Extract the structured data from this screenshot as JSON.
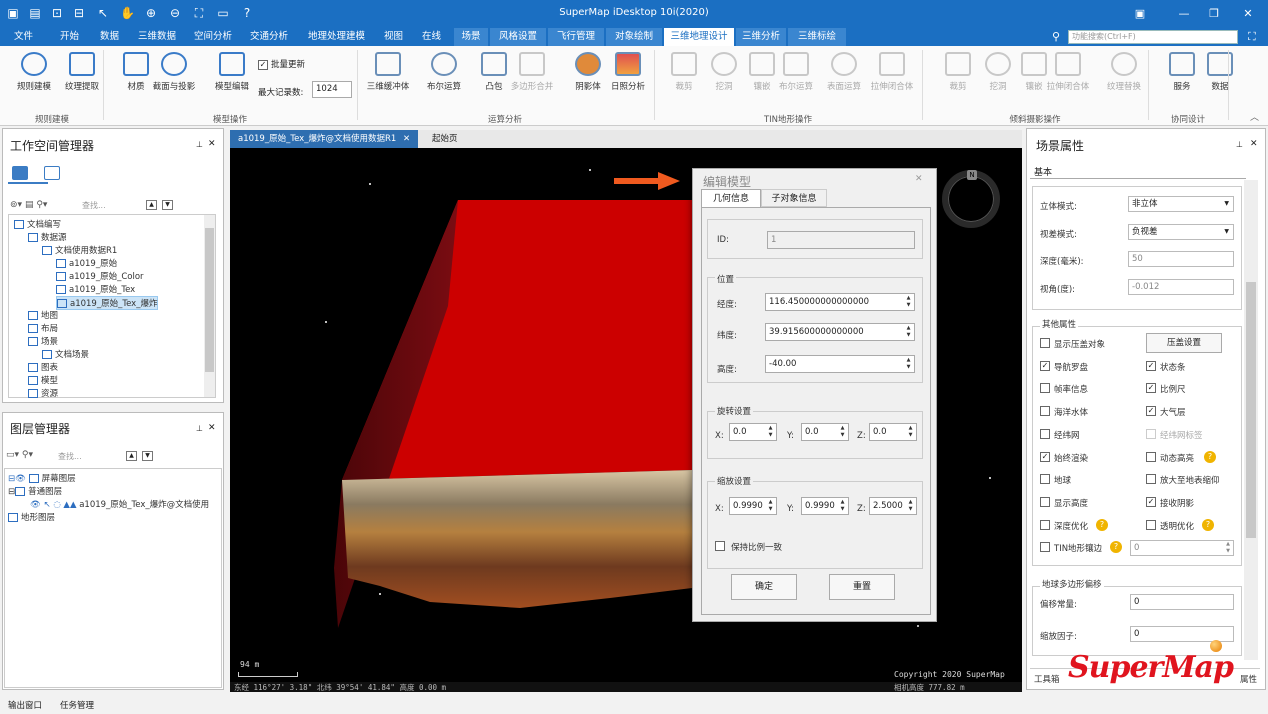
{
  "app": {
    "title": "SuperMap iDesktop 10i(2020)"
  },
  "menu": [
    "文件",
    "开始",
    "数据",
    "三维数据",
    "空间分析",
    "交通分析",
    "地理处理建模",
    "视图",
    "在线",
    "场景",
    "风格设置",
    "飞行管理",
    "对象绘制",
    "三维地理设计",
    "三维分析",
    "三维标绘"
  ],
  "search": {
    "placeholder": "功能搜索(Ctrl+F)"
  },
  "ribbon": {
    "items": [
      "规则建模",
      "纹理提取",
      "材质",
      "截面与投影",
      "模型编辑",
      "三维缓冲体",
      "布尔运算",
      "凸包",
      "多边形合并",
      "阴影体",
      "日照分析",
      "裁剪",
      "挖洞",
      "镶嵌",
      "布尔运算",
      "表面运算",
      "拉伸闭合体",
      "裁剪",
      "挖洞",
      "镶嵌",
      "拉伸闭合体",
      "纹理替换",
      "服务",
      "数据"
    ],
    "batch_update": "批量更新",
    "max_records_label": "最大记录数:",
    "max_records": "1024",
    "groups": [
      "规则建模",
      "模型操作",
      "运算分析",
      "TIN地形操作",
      "倾斜摄影操作",
      "协同设计"
    ]
  },
  "workspace": {
    "title": "工作空间管理器",
    "search_placeholder": "查找...",
    "tree": [
      "文档编写",
      "数据源",
      "文档使用数据R1",
      "a1019_原始",
      "a1019_原始_Color",
      "a1019_原始_Tex",
      "a1019_原始_Tex_爆炸",
      "地图",
      "布局",
      "场景",
      "文档场景",
      "图表",
      "模型",
      "资源"
    ]
  },
  "layers": {
    "title": "图层管理器",
    "search_placeholder": "查找...",
    "tree": [
      "屏幕图层",
      "普通图层",
      "a1019_原始_Tex_爆炸@文档使用",
      "地形图层"
    ]
  },
  "tabs": [
    "a1019_原始_Tex_爆炸@文档使用数据R1",
    "起始页"
  ],
  "scene": {
    "scale": "94 m",
    "copyright": "Copyright 2020 SuperMap",
    "coords": "东经 116°27' 3.18\"   北纬 39°54' 41.84\"  高度 0.00 m",
    "camera": "相机高度 777.82 m",
    "compass": "N"
  },
  "dialog": {
    "title": "编辑模型",
    "tabs": [
      "几何信息",
      "子对象信息"
    ],
    "id_label": "ID:",
    "id": "1",
    "position_label": "位置",
    "lon_label": "经度:",
    "lon": "116.450000000000000",
    "lat_label": "纬度:",
    "lat": "39.915600000000000",
    "alt_label": "高度:",
    "alt": "-40.00",
    "rotation_label": "旋转设置",
    "rx": "0.0",
    "ry": "0.0",
    "rz": "0.0",
    "scale_label": "缩放设置",
    "sx": "0.9990",
    "sy": "0.9990",
    "sz": "2.5000",
    "x": "X:",
    "y": "Y:",
    "z": "Z:",
    "keep_ratio": "保持比例一致",
    "ok": "确定",
    "reset": "重置"
  },
  "props": {
    "title": "场景属性",
    "tab": "基本",
    "stereo_label": "立体模式:",
    "stereo": "非立体",
    "parallax_label": "视差模式:",
    "parallax": "负视差",
    "depth_label": "深度(毫米):",
    "depth": "50",
    "angle_label": "视角(度):",
    "angle": "-0.012",
    "other_label": "其他属性",
    "press_btn": "压盖设置",
    "checks": [
      [
        "显示压盖对象",
        false
      ],
      [
        "导航罗盘",
        true
      ],
      [
        "状态条",
        true
      ],
      [
        "帧率信息",
        false
      ],
      [
        "比例尺",
        true
      ],
      [
        "海洋水体",
        false
      ],
      [
        "大气层",
        true
      ],
      [
        "经纬网",
        false
      ],
      [
        "经纬网标签",
        false
      ],
      [
        "始终渲染",
        true
      ],
      [
        "动态高亮",
        false
      ],
      [
        "地球",
        false
      ],
      [
        "放大至地表缩仰",
        false
      ],
      [
        "显示高度",
        false
      ],
      [
        "接收阴影",
        true
      ],
      [
        "深度优化",
        false
      ],
      [
        "透明优化",
        false
      ],
      [
        "TIN地形镶边",
        false
      ]
    ],
    "tin_value": "0",
    "poly_label": "地球多边形偏移",
    "offset_label": "偏移常量:",
    "offset": "0",
    "factor_label": "缩放因子:",
    "factor": "0"
  },
  "bottom_tabs": [
    "工具箱",
    "属性"
  ],
  "status": [
    "输出窗口",
    "任务管理"
  ],
  "logo": "SuperMap"
}
